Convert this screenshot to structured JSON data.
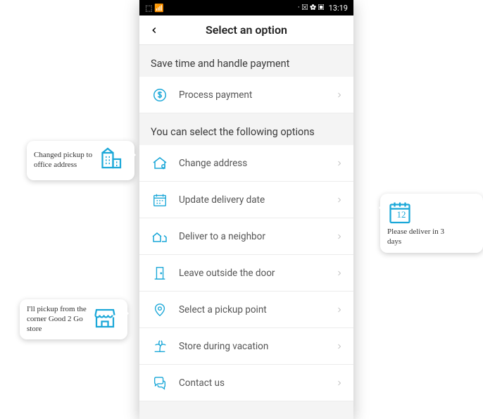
{
  "status": {
    "time": "13:19",
    "icons_right": "· ⮽ ✿ ▣",
    "icons_left": "⬚ 📶"
  },
  "header": {
    "title": "Select an option"
  },
  "sections": {
    "payment_label": "Save time and handle payment",
    "options_label": "You can select the following options"
  },
  "items": {
    "process_payment": "Process payment",
    "change_address": "Change address",
    "update_delivery_date": "Update delivery date",
    "deliver_neighbor": "Deliver to a neighbor",
    "leave_outside": "Leave outside the door",
    "pickup_point": "Select a pickup point",
    "store_vacation": "Store during vacation",
    "contact_us": "Contact us"
  },
  "annotations": {
    "addr": "Changed pickup to office address",
    "store": "I'll pickup from the corner Good 2 Go store",
    "date": "Please deliver in 3 days",
    "cal_num": "12"
  },
  "colors": {
    "accent": "#1aa7d8"
  }
}
